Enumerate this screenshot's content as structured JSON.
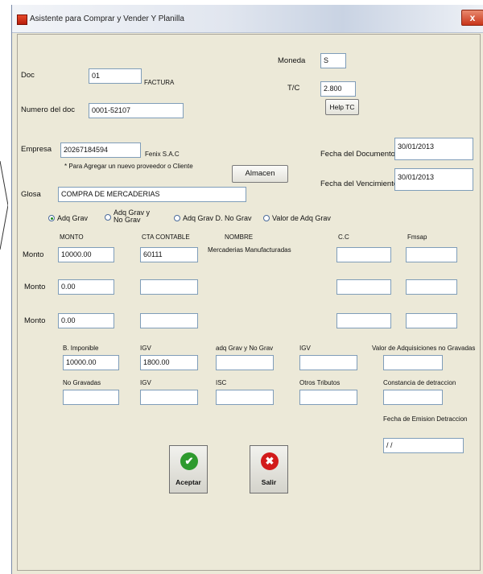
{
  "window": {
    "title": "Asistente para Comprar y Vender Y Planilla",
    "close": "x"
  },
  "doc": {
    "label": "Doc",
    "value": "01",
    "type_name": "FACTURA"
  },
  "numero": {
    "label": "Numero del doc",
    "value": "0001-52107"
  },
  "moneda": {
    "label": "Moneda",
    "value": "S"
  },
  "tc": {
    "label": "T/C",
    "value": "2.800",
    "help_label": "Help TC"
  },
  "empresa": {
    "label": "Empresa",
    "value": "20267184594",
    "name": "Fenix S.A.C",
    "note": "* Para Agregar un nuevo proveedor o Cliente"
  },
  "almacen_button": "Almacen",
  "fecha_documento": {
    "label": "Fecha del Documento",
    "value": "30/01/2013"
  },
  "fecha_vencimiento": {
    "label": "Fecha del Vencimiento",
    "value": "30/01/2013"
  },
  "glosa": {
    "label": "Glosa",
    "value": "COMPRA DE MERCADERIAS"
  },
  "radios": [
    {
      "label": "Adq Grav",
      "selected": true
    },
    {
      "label": "Adq Grav y\nNo Grav",
      "selected": false
    },
    {
      "label": "Adq Grav D. No Grav",
      "selected": false
    },
    {
      "label": "Valor de Adq Grav",
      "selected": false
    }
  ],
  "columns": {
    "monto": "MONTO",
    "cta": "CTA CONTABLE",
    "nombre": "NOMBRE",
    "cc": "C.C",
    "fmsap": "Fmsap"
  },
  "rows": [
    {
      "label": "Monto",
      "monto": "10000.00",
      "cta": "60111",
      "nombre": "Mercaderias Manufacturadas",
      "cc": "",
      "fmsap": ""
    },
    {
      "label": "Monto",
      "monto": "0.00",
      "cta": "",
      "nombre": "",
      "cc": "",
      "fmsap": ""
    },
    {
      "label": "Monto",
      "monto": "0.00",
      "cta": "",
      "nombre": "",
      "cc": "",
      "fmsap": ""
    }
  ],
  "totals1": [
    {
      "label": "B. Imponible",
      "value": "10000.00"
    },
    {
      "label": "IGV",
      "value": "1800.00"
    },
    {
      "label": "adq Grav y No Grav",
      "value": ""
    },
    {
      "label": "IGV",
      "value": ""
    },
    {
      "label": "Valor de Adquisiciones no Gravadas",
      "value": ""
    }
  ],
  "totals2": [
    {
      "label": "No Gravadas",
      "value": ""
    },
    {
      "label": "IGV",
      "value": ""
    },
    {
      "label": "ISC",
      "value": ""
    },
    {
      "label": "Otros Tributos",
      "value": ""
    },
    {
      "label": "Constancia de detraccion",
      "value": ""
    }
  ],
  "fecha_emision": {
    "label": "Fecha de Emision Detraccion",
    "value": "/ /"
  },
  "aceptar": {
    "label": "Aceptar",
    "icon": "check-icon",
    "color": "#2e9a2e"
  },
  "salir": {
    "label": "Salir",
    "icon": "x-icon",
    "color": "#d21a1a"
  }
}
